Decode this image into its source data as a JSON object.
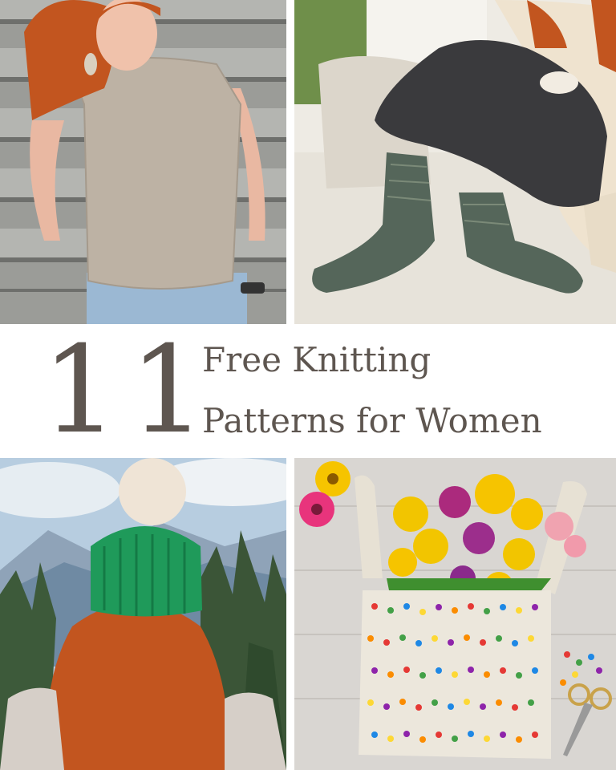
{
  "collage": {
    "number": "11",
    "title_line_1": "Free Knitting",
    "title_line_2": "Patterns for Women"
  },
  "colors": {
    "title_text": "#5e5650",
    "background": "#ffffff",
    "hat_green": "#1f9a5a",
    "hair_red": "#c2551f"
  },
  "photos": [
    "knit-top-photo",
    "knit-socks-photo",
    "green-beanie-photo",
    "polka-dot-tote-photo"
  ]
}
